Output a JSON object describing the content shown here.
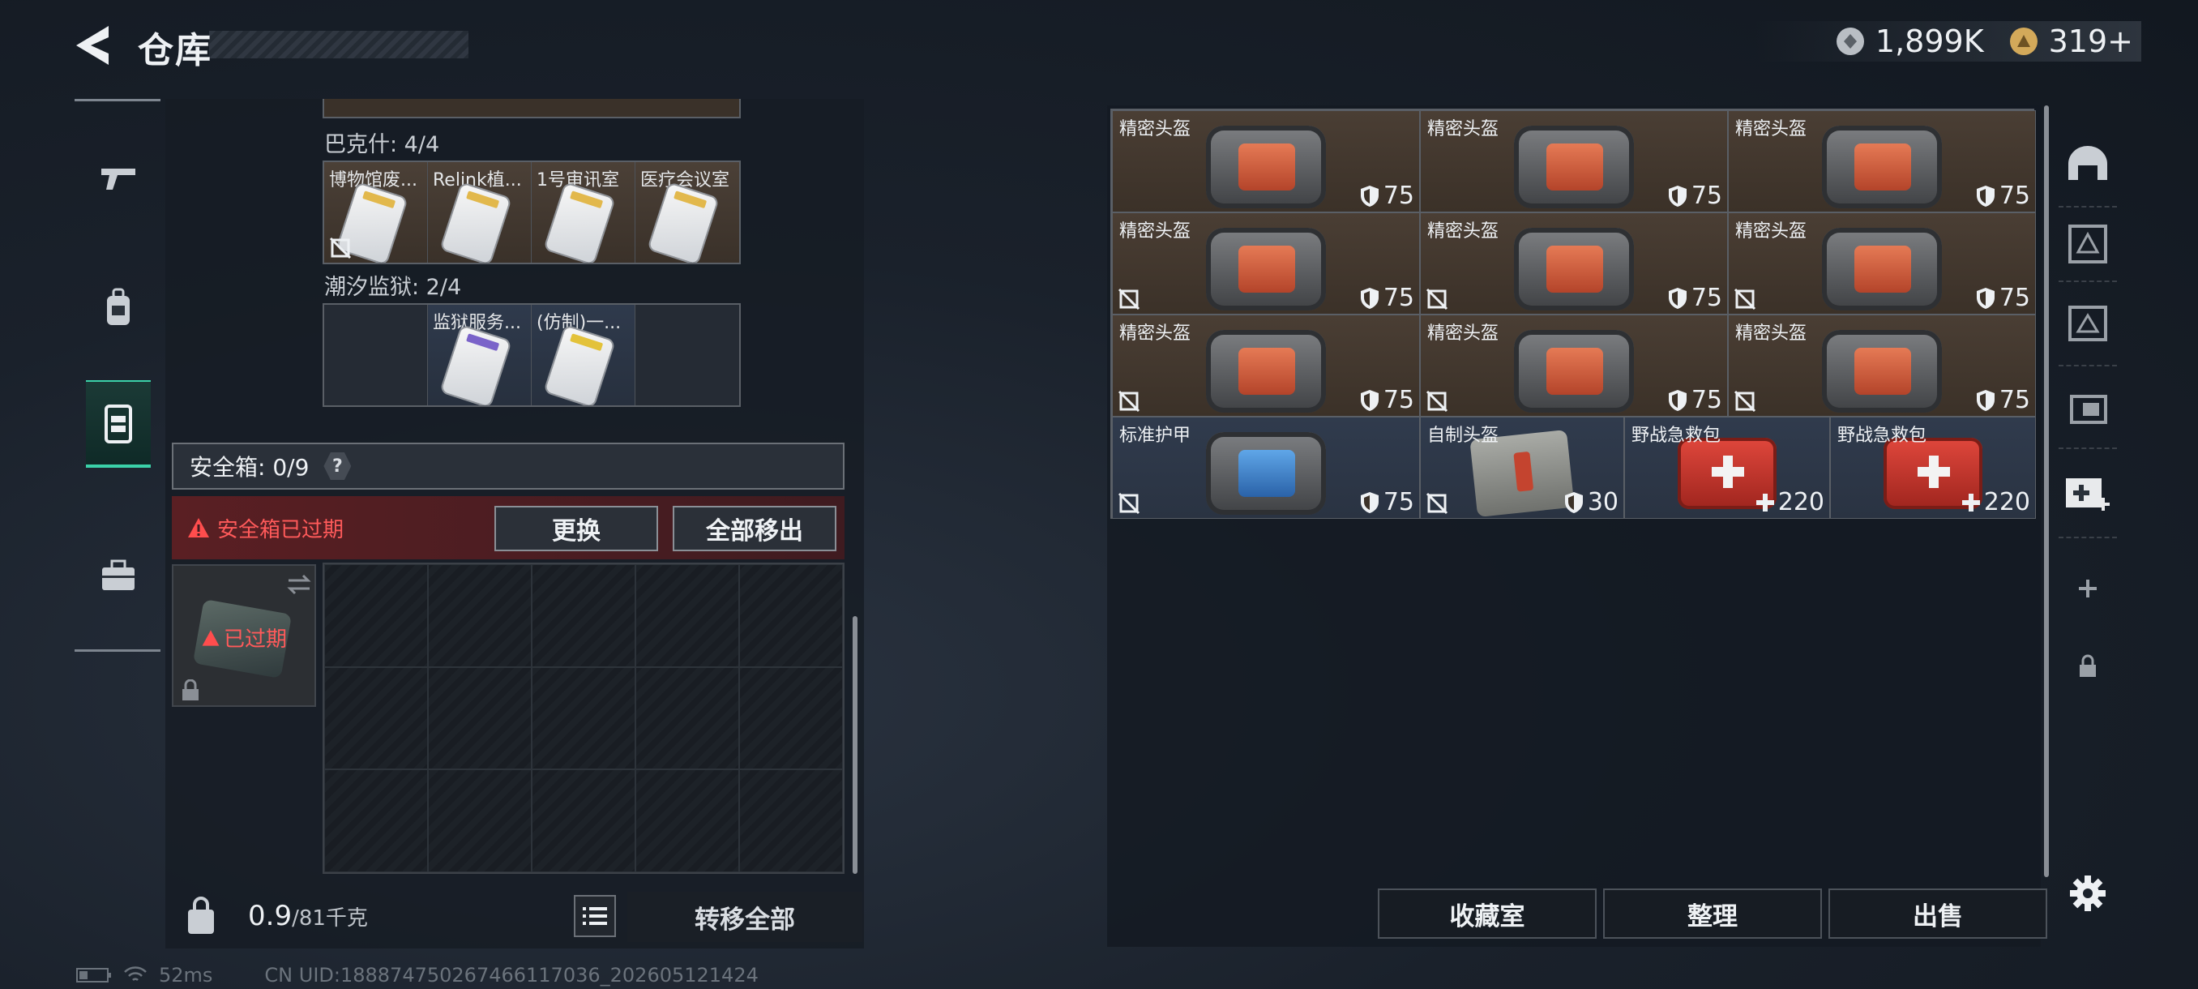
{
  "header": {
    "title": "仓库",
    "currency": [
      {
        "icon": "silver-coin-icon",
        "value": "1,899K"
      },
      {
        "icon": "gold-coin-icon",
        "value": "319+"
      }
    ]
  },
  "left_nav": [
    "weapon-tab-icon",
    "backpack-tab-icon",
    "chest-rig-tab-icon",
    "toolbox-tab-icon"
  ],
  "key_sections": [
    {
      "title": "巴克什: 4/4",
      "cells": [
        "博物馆废...",
        "Relink植...",
        "1号审讯室",
        "医疗会议室"
      ]
    },
    {
      "title": "潮汐监狱: 2/4",
      "cells": [
        "",
        "监狱服务...",
        "(仿制)一..."
      ]
    }
  ],
  "safe_box": {
    "label": "安全箱: 0/9",
    "help": "?",
    "expired_notice": "安全箱已过期",
    "replace_button": "更换",
    "remove_all_button": "全部移出",
    "slot_status": "已过期"
  },
  "weight": {
    "current": "0.9",
    "max": "/81千克"
  },
  "transfer_all": "转移全部",
  "status_bar": {
    "ping": "52ms",
    "uid": "CN UID:188874750267466117036_202605121424"
  },
  "items": [
    {
      "name": "精密头盔",
      "value": "75",
      "type": "shield",
      "marked": false
    },
    {
      "name": "精密头盔",
      "value": "75",
      "type": "shield",
      "marked": false
    },
    {
      "name": "精密头盔",
      "value": "75",
      "type": "shield",
      "marked": false
    },
    {
      "name": "精密头盔",
      "value": "75",
      "type": "shield",
      "marked": true
    },
    {
      "name": "精密头盔",
      "value": "75",
      "type": "shield",
      "marked": true
    },
    {
      "name": "精密头盔",
      "value": "75",
      "type": "shield",
      "marked": true
    },
    {
      "name": "精密头盔",
      "value": "75",
      "type": "shield",
      "marked": true
    },
    {
      "name": "精密头盔",
      "value": "75",
      "type": "shield",
      "marked": true
    },
    {
      "name": "精密头盔",
      "value": "75",
      "type": "shield",
      "marked": true
    },
    {
      "name": "标准护甲",
      "value": "75",
      "type": "shield",
      "marked": true
    },
    {
      "name": "自制头盔",
      "value": "30",
      "type": "shield",
      "marked": true
    },
    {
      "name": "野战急救包",
      "value": "220",
      "type": "heal",
      "marked": false
    },
    {
      "name": "野战急救包",
      "value": "220",
      "type": "heal",
      "marked": false
    }
  ],
  "right_nav": [
    "helmet-filter-icon",
    "armor-filter-icon-1",
    "armor-filter-icon-2",
    "armor-filter-icon-3",
    "medkit-filter-icon",
    "add-icon",
    "lock-icon"
  ],
  "bottom_buttons": {
    "collection": "收藏室",
    "organize": "整理",
    "sell": "出售"
  }
}
